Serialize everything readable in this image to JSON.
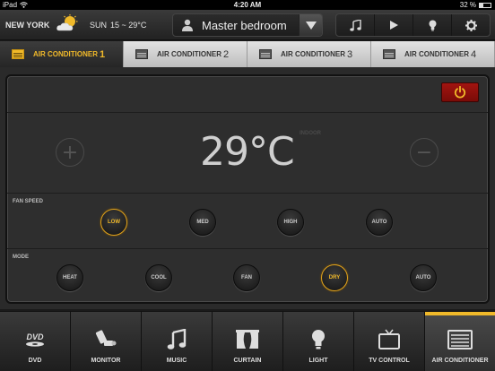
{
  "status": {
    "device": "iPad",
    "time": "4:20 AM",
    "battery": "32 %",
    "battery_level": 0.32
  },
  "header": {
    "city": "NEW YORK",
    "day": "SUN",
    "temp_range": "15 ~ 29°C",
    "room": "Master bedroom"
  },
  "tabs": [
    {
      "label": "AIR CONDITIONER",
      "num": "1",
      "active": true
    },
    {
      "label": "AIR CONDITIONER",
      "num": "2",
      "active": false
    },
    {
      "label": "AIR CONDITIONER",
      "num": "3",
      "active": false
    },
    {
      "label": "AIR CONDITIONER",
      "num": "4",
      "active": false
    }
  ],
  "panel": {
    "temperature": "29°C",
    "indoor_label": "INDOOR",
    "fan_speed_label": "FAN SPEED",
    "fan_speeds": [
      "LOW",
      "MED",
      "HIGH",
      "AUTO"
    ],
    "fan_selected": "LOW",
    "mode_label": "MODE",
    "modes": [
      "HEAT",
      "COOL",
      "FAN",
      "DRY",
      "AUTO"
    ],
    "mode_selected": "DRY"
  },
  "dock": [
    {
      "label": "DVD",
      "icon": "dvd-icon"
    },
    {
      "label": "MONITOR",
      "icon": "monitor-icon"
    },
    {
      "label": "MUSIC",
      "icon": "music-icon"
    },
    {
      "label": "CURTAIN",
      "icon": "curtain-icon"
    },
    {
      "label": "LIGHT",
      "icon": "light-icon"
    },
    {
      "label": "TV CONTROL",
      "icon": "tv-icon"
    },
    {
      "label": "AIR CONDITIONER",
      "icon": "air-conditioner-icon",
      "active": true
    }
  ],
  "colors": {
    "accent": "#f0b92a",
    "power": "#a21410"
  }
}
